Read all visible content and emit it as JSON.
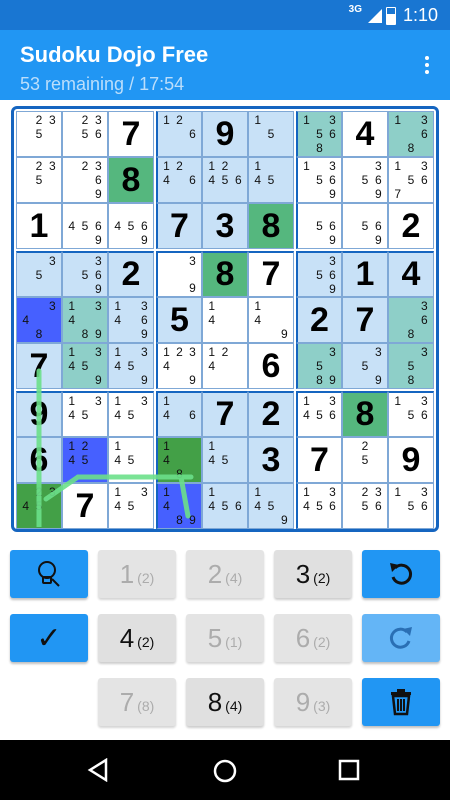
{
  "status": {
    "network": "3G",
    "time": "1:10"
  },
  "app": {
    "title": "Sudoku Dojo Free",
    "subtitle": "53 remaining / 17:54"
  },
  "colors": {
    "appbar": "#2196F3",
    "statusbar": "#1976D2",
    "light": "#C8E1F7",
    "teal": "#BADFDC",
    "teal_mid": "#8ECFC8",
    "green": "#55B77E",
    "dark_green": "#43A047",
    "blue": "#4660FF"
  },
  "board": {
    "rows": [
      [
        {
          "c": "235"
        },
        {
          "c": "2356"
        },
        {
          "v": "7"
        },
        {
          "c": "126"
        },
        {
          "v": "9"
        },
        {
          "c": "15"
        },
        {
          "c": "13568"
        },
        {
          "v": "4"
        },
        {
          "c": "1368"
        }
      ],
      [
        {
          "c": "235"
        },
        {
          "c": "2369"
        },
        {
          "v": "8"
        },
        {
          "c": "1246"
        },
        {
          "c": "12456"
        },
        {
          "c": "145"
        },
        {
          "c": "13569"
        },
        {
          "c": "3569"
        },
        {
          "c": "13567"
        }
      ],
      [
        {
          "v": "1"
        },
        {
          "c": "4569"
        },
        {
          "c": "4569"
        },
        {
          "v": "7"
        },
        {
          "v": "3"
        },
        {
          "v": "8"
        },
        {
          "c": "569"
        },
        {
          "c": "569"
        },
        {
          "v": "2"
        }
      ],
      [
        {
          "c": "35"
        },
        {
          "c": "3569"
        },
        {
          "v": "2"
        },
        {
          "c": "39"
        },
        {
          "v": "8"
        },
        {
          "v": "7"
        },
        {
          "c": "3569"
        },
        {
          "v": "1"
        },
        {
          "v": "4"
        }
      ],
      [
        {
          "c": "348"
        },
        {
          "c": "13489"
        },
        {
          "c": "13469"
        },
        {
          "v": "5"
        },
        {
          "c": "14"
        },
        {
          "c": "149"
        },
        {
          "v": "2"
        },
        {
          "v": "7"
        },
        {
          "c": "368"
        }
      ],
      [
        {
          "v": "7"
        },
        {
          "c": "13459"
        },
        {
          "c": "13459"
        },
        {
          "c": "12349"
        },
        {
          "c": "124"
        },
        {
          "v": "6"
        },
        {
          "c": "3589"
        },
        {
          "c": "359"
        },
        {
          "c": "358"
        }
      ],
      [
        {
          "v": "9"
        },
        {
          "c": "1345"
        },
        {
          "c": "1345"
        },
        {
          "c": "146"
        },
        {
          "v": "7"
        },
        {
          "v": "2"
        },
        {
          "c": "13456"
        },
        {
          "v": "8"
        },
        {
          "c": "1356"
        }
      ],
      [
        {
          "v": "6"
        },
        {
          "c": "1245"
        },
        {
          "c": "145"
        },
        {
          "c": "148"
        },
        {
          "c": "145"
        },
        {
          "v": "3"
        },
        {
          "v": "7"
        },
        {
          "c": "25"
        },
        {
          "v": "9"
        }
      ],
      [
        {
          "c": "2345"
        },
        {
          "v": "7"
        },
        {
          "c": "1345"
        },
        {
          "c": "1489"
        },
        {
          "c": "1456"
        },
        {
          "c": "1459"
        },
        {
          "c": "13456"
        },
        {
          "c": "2356"
        },
        {
          "c": "1356"
        }
      ]
    ]
  },
  "controls": {
    "hint_icon": "lightbulb-icon",
    "check_symbol": "✓",
    "undo_icon": "undo-icon",
    "redo_icon": "redo-icon",
    "delete_icon": "trash-icon",
    "numbers": [
      {
        "digit": "1",
        "count": "(2)"
      },
      {
        "digit": "2",
        "count": "(4)"
      },
      {
        "digit": "3",
        "count": "(2)"
      },
      {
        "digit": "4",
        "count": "(2)"
      },
      {
        "digit": "5",
        "count": "(1)"
      },
      {
        "digit": "6",
        "count": "(2)"
      },
      {
        "digit": "7",
        "count": "(8)"
      },
      {
        "digit": "8",
        "count": "(4)"
      },
      {
        "digit": "9",
        "count": "(3)"
      }
    ]
  },
  "nav": {
    "back": "back-icon",
    "home": "home-icon",
    "recents": "recents-icon"
  }
}
